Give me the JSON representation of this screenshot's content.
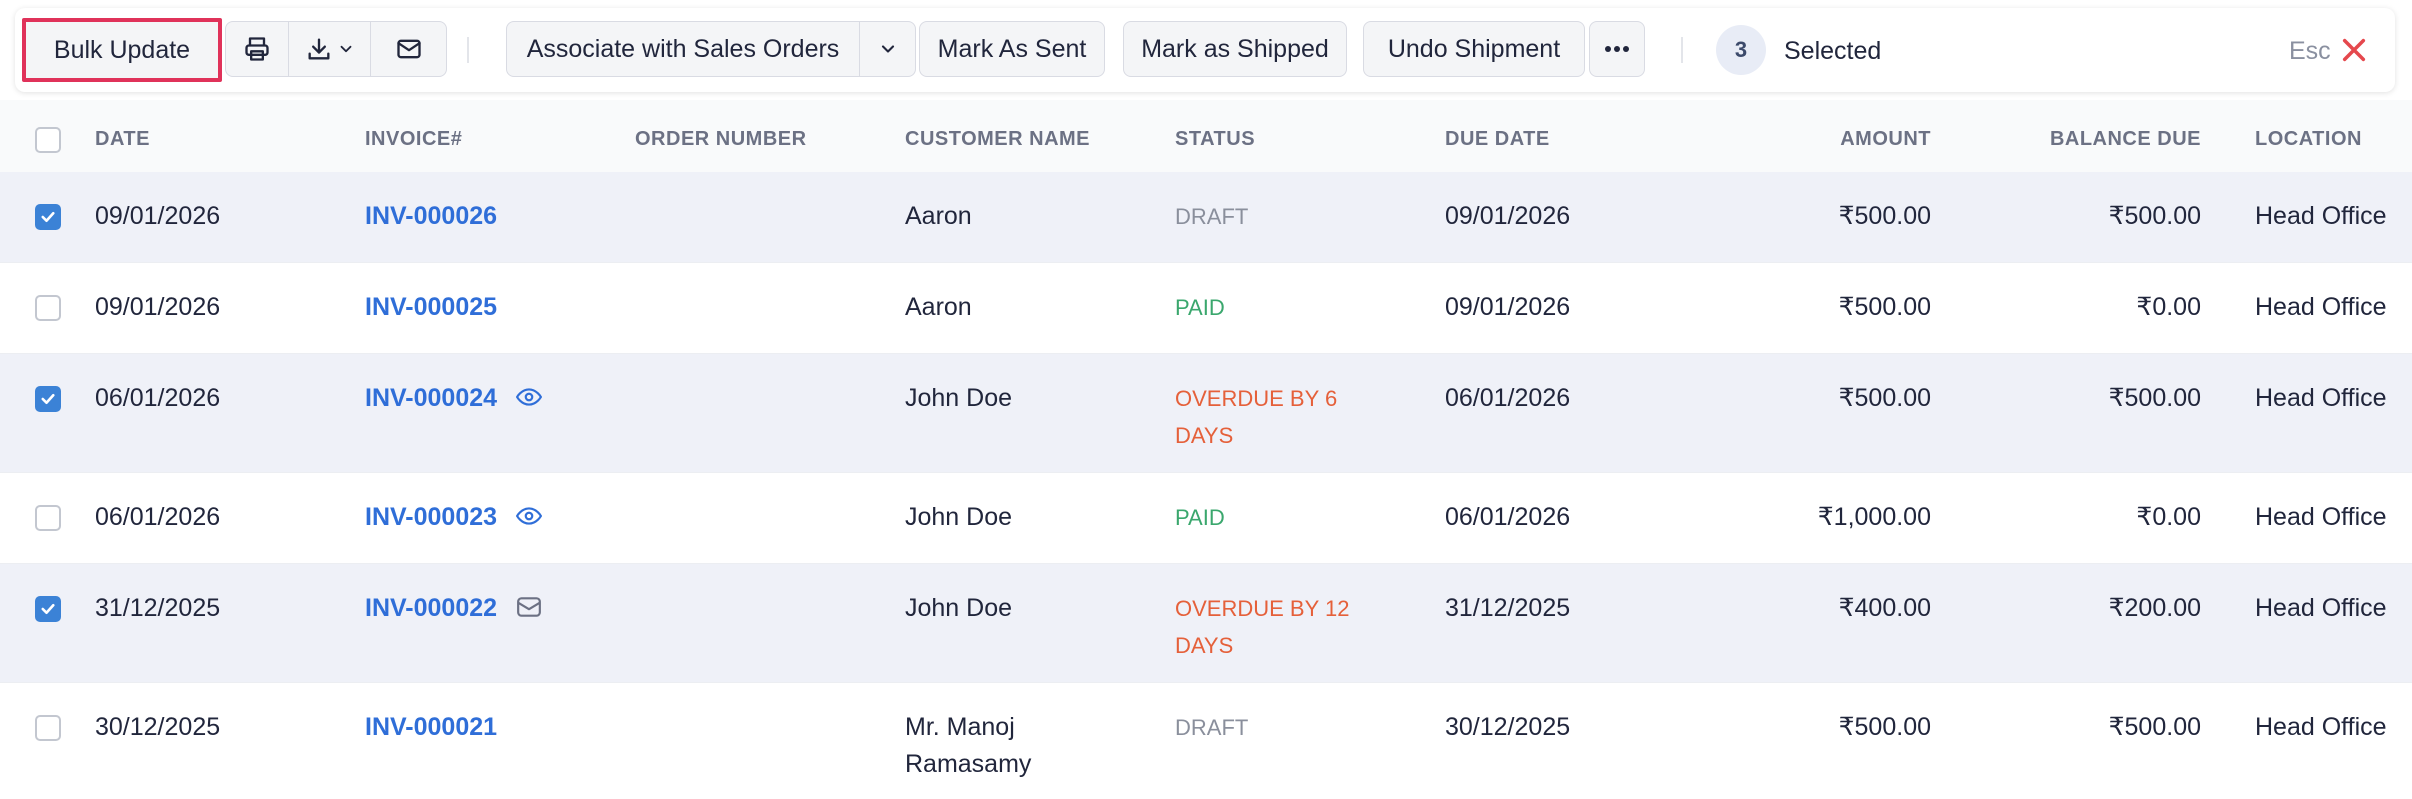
{
  "toolbar": {
    "bulk_update_label": "Bulk Update",
    "print_icon": "printer-icon",
    "download_icon": "download-icon",
    "email_icon": "mail-icon",
    "associate_label": "Associate with Sales Orders",
    "mark_sent_label": "Mark As Sent",
    "mark_shipped_label": "Mark as Shipped",
    "undo_shipment_label": "Undo Shipment",
    "more_icon": "more-horizontal-icon",
    "selected_count": "3",
    "selected_label": "Selected",
    "esc_label": "Esc",
    "highlight_color": "#e0325a",
    "close_color": "#e5484d"
  },
  "table": {
    "headers": {
      "date": "DATE",
      "invoice": "INVOICE#",
      "order_number": "ORDER NUMBER",
      "customer_name": "CUSTOMER NAME",
      "status": "STATUS",
      "due_date": "DUE DATE",
      "amount": "AMOUNT",
      "balance_due": "BALANCE DUE",
      "location": "LOCATION"
    },
    "rows": [
      {
        "selected": true,
        "date": "09/01/2026",
        "invoice": "INV-000026",
        "order_number": "",
        "customer_line1": "Aaron",
        "customer_line2": "",
        "status_line1": "DRAFT",
        "status_line2": "",
        "due_date": "09/01/2026",
        "amount": "₹500.00",
        "balance_due": "₹500.00",
        "location": "Head Office"
      },
      {
        "selected": false,
        "date": "09/01/2026",
        "invoice": "INV-000025",
        "order_number": "",
        "customer_line1": "Aaron",
        "customer_line2": "",
        "status_line1": "PAID",
        "status_line2": "",
        "due_date": "09/01/2026",
        "amount": "₹500.00",
        "balance_due": "₹0.00",
        "location": "Head Office"
      },
      {
        "selected": true,
        "date": "06/01/2026",
        "invoice": "INV-000024",
        "order_number": "",
        "customer_line1": "John Doe",
        "customer_line2": "",
        "status_line1": "OVERDUE BY 6",
        "status_line2": "DAYS",
        "due_date": "06/01/2026",
        "amount": "₹500.00",
        "balance_due": "₹500.00",
        "location": "Head Office"
      },
      {
        "selected": false,
        "date": "06/01/2026",
        "invoice": "INV-000023",
        "order_number": "",
        "customer_line1": "John Doe",
        "customer_line2": "",
        "status_line1": "PAID",
        "status_line2": "",
        "due_date": "06/01/2026",
        "amount": "₹1,000.00",
        "balance_due": "₹0.00",
        "location": "Head Office"
      },
      {
        "selected": true,
        "date": "31/12/2025",
        "invoice": "INV-000022",
        "order_number": "",
        "customer_line1": "John Doe",
        "customer_line2": "",
        "status_line1": "OVERDUE BY 12",
        "status_line2": "DAYS",
        "due_date": "31/12/2025",
        "amount": "₹400.00",
        "balance_due": "₹200.00",
        "location": "Head Office"
      },
      {
        "selected": false,
        "date": "30/12/2025",
        "invoice": "INV-000021",
        "order_number": "",
        "customer_line1": "Mr. Manoj",
        "customer_line2": "Ramasamy",
        "status_line1": "DRAFT",
        "status_line2": "",
        "due_date": "30/12/2025",
        "amount": "₹500.00",
        "balance_due": "₹500.00",
        "location": "Head Office"
      }
    ]
  },
  "icons": {
    "row_24": "eye-icon",
    "row_23": "eye-icon",
    "row_22": "mail-icon"
  },
  "colors": {
    "link": "#2f6ed8",
    "paid": "#3aa76d",
    "overdue": "#e5603a",
    "draft": "#8a8f9c",
    "checkbox_checked": "#3b82d6",
    "selected_row_bg": "#eff1f8"
  }
}
